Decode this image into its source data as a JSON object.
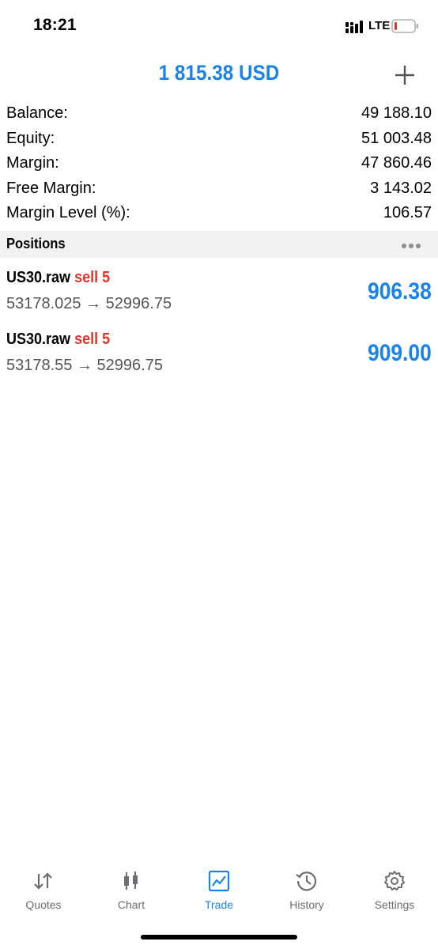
{
  "status_bar": {
    "time": "18:21",
    "network": "LTE",
    "icons": [
      "signal-icon",
      "battery-low-icon"
    ]
  },
  "header": {
    "amount": "1 815.38 USD",
    "add_icon": "plus-icon"
  },
  "summary": [
    {
      "label": "Balance:",
      "value": "49 188.10"
    },
    {
      "label": "Equity:",
      "value": "51 003.48"
    },
    {
      "label": "Margin:",
      "value": "47 860.46"
    },
    {
      "label": "Free Margin:",
      "value": "3 143.02"
    },
    {
      "label": "Margin Level (%):",
      "value": "106.57"
    }
  ],
  "positions_section": {
    "title": "Positions",
    "more_icon": "more-dots-icon"
  },
  "positions": [
    {
      "symbol": "US30.raw",
      "side": "sell 5",
      "prices": "53178.025 → 52996.75",
      "profit": "906.38"
    },
    {
      "symbol": "US30.raw",
      "side": "sell 5",
      "prices": "53178.55 → 52996.75",
      "profit": "909.00"
    }
  ],
  "tabs": [
    {
      "label": "Quotes",
      "icon": "quotes-arrows-icon",
      "active": false
    },
    {
      "label": "Chart",
      "icon": "candlestick-icon",
      "active": false
    },
    {
      "label": "Trade",
      "icon": "trade-chart-icon",
      "active": true
    },
    {
      "label": "History",
      "icon": "history-clock-icon",
      "active": false
    },
    {
      "label": "Settings",
      "icon": "gear-icon",
      "active": false
    }
  ],
  "colors": {
    "accent": "#1a83e8",
    "sell": "#e0352b",
    "inactive_tab": "#6d6d72",
    "section_bg": "#f2f2f2"
  }
}
